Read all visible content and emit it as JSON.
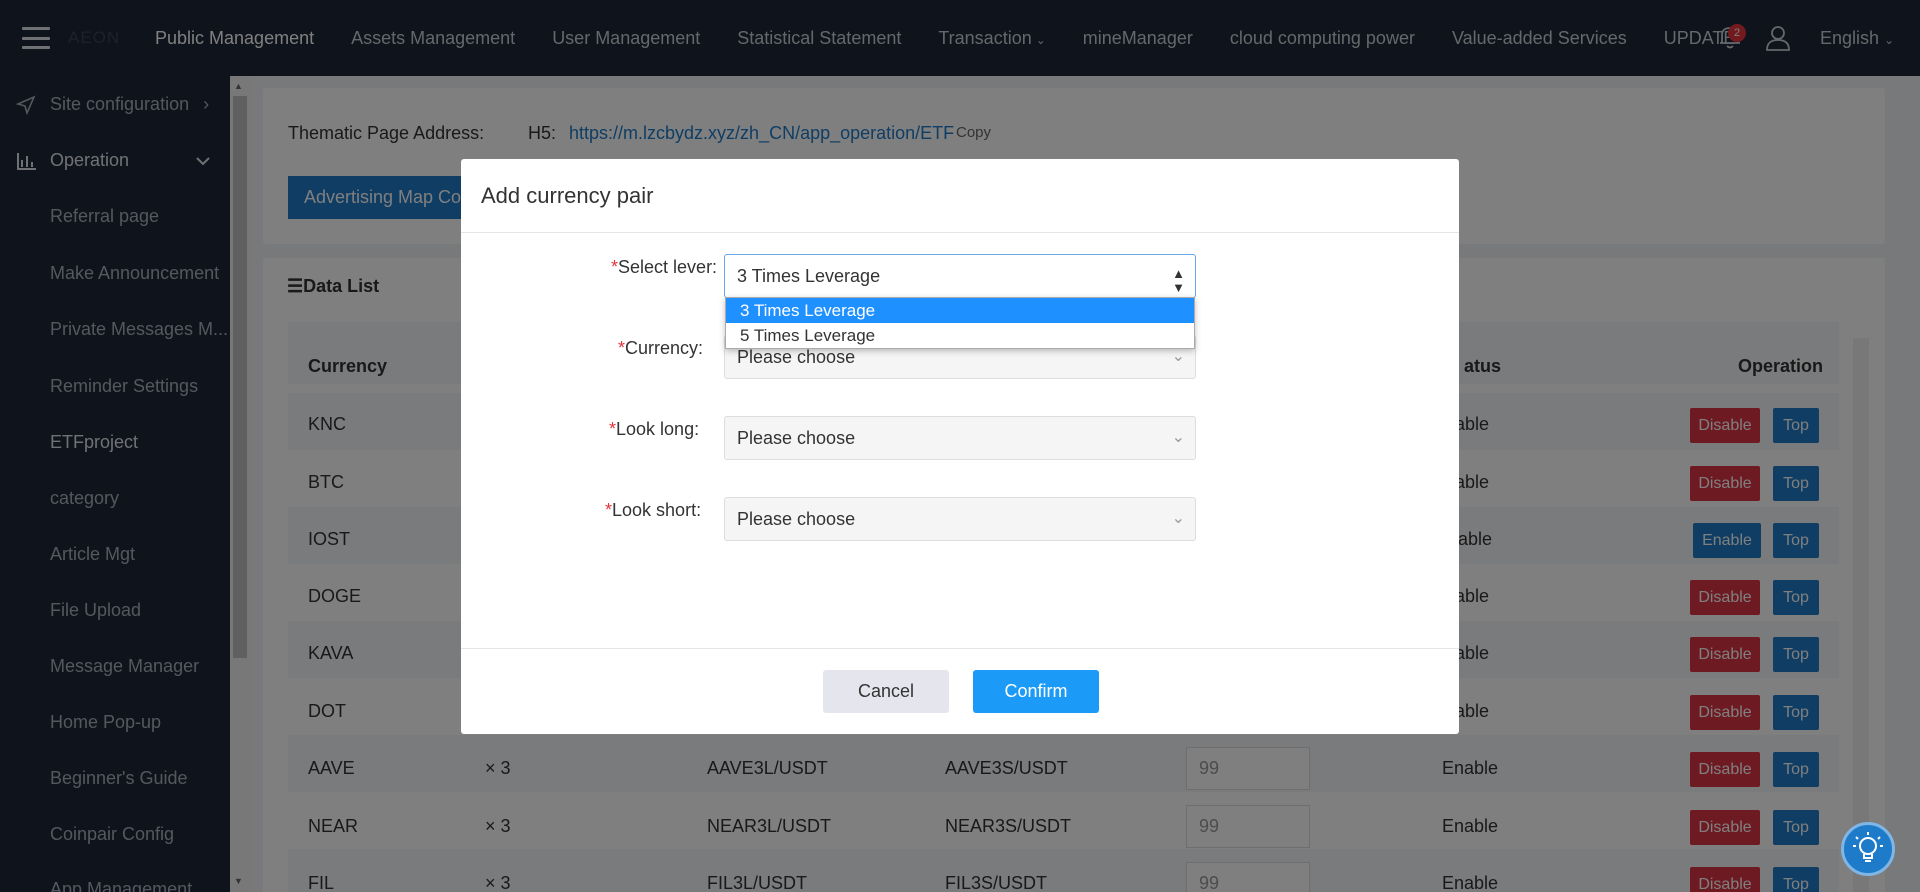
{
  "header": {
    "brand": "AEON",
    "nav": [
      "Public Management",
      "Assets Management",
      "User Management",
      "Statistical Statement",
      "Transaction",
      "mineManager",
      "cloud computing power",
      "Value-added Services",
      "UPDATE"
    ],
    "badge_count": "2",
    "language": "English"
  },
  "sidebar": {
    "site_configuration": "Site configuration",
    "operation": "Operation",
    "items": [
      "Referral page",
      "Make Announcement",
      "Private Messages M...",
      "Reminder Settings",
      "ETFproject",
      "category",
      "Article Mgt",
      "File Upload",
      "Message Manager",
      "Home Pop-up",
      "Beginner's Guide",
      "Coinpair Config"
    ],
    "app_management": "App Management"
  },
  "thematic": {
    "label": "Thematic Page Address:",
    "h5_label": "H5:",
    "url": "https://m.lzcbydz.xyz/zh_CN/app_operation/ETF",
    "copy": "Copy",
    "advertising_button": "Advertising Map Co"
  },
  "data_list": {
    "title": "Data List",
    "headers": {
      "currency": "Currency",
      "status": "atus",
      "operation": "Operation"
    },
    "rows": [
      {
        "currency": "KNC",
        "lever": "",
        "long": "",
        "short": "",
        "sort": "",
        "status": "nable",
        "action": "Disable",
        "top": "Top"
      },
      {
        "currency": "BTC",
        "lever": "",
        "long": "",
        "short": "",
        "sort": "",
        "status": "nable",
        "action": "Disable",
        "top": "Top"
      },
      {
        "currency": "IOST",
        "lever": "",
        "long": "",
        "short": "",
        "sort": "",
        "status": "isable",
        "action": "Enable",
        "top": "Top"
      },
      {
        "currency": "DOGE",
        "lever": "",
        "long": "",
        "short": "",
        "sort": "",
        "status": "nable",
        "action": "Disable",
        "top": "Top"
      },
      {
        "currency": "KAVA",
        "lever": "",
        "long": "",
        "short": "",
        "sort": "",
        "status": "nable",
        "action": "Disable",
        "top": "Top"
      },
      {
        "currency": "DOT",
        "lever": "",
        "long": "",
        "short": "",
        "sort": "",
        "status": "nable",
        "action": "Disable",
        "top": "Top"
      },
      {
        "currency": "AAVE",
        "lever": "× 3",
        "long": "AAVE3L/USDT",
        "short": "AAVE3S/USDT",
        "sort": "99",
        "status": "Enable",
        "action": "Disable",
        "top": "Top"
      },
      {
        "currency": "NEAR",
        "lever": "× 3",
        "long": "NEAR3L/USDT",
        "short": "NEAR3S/USDT",
        "sort": "99",
        "status": "Enable",
        "action": "Disable",
        "top": "Top"
      },
      {
        "currency": "FIL",
        "lever": "× 3",
        "long": "FIL3L/USDT",
        "short": "FIL3S/USDT",
        "sort": "99",
        "status": "Enable",
        "action": "Disable",
        "top": "Top"
      }
    ]
  },
  "modal": {
    "title": "Add currency pair",
    "select_lever_label": "Select lever:",
    "select_lever_value": "3 Times Leverage",
    "lever_options": [
      "3 Times Leverage",
      "5 Times Leverage"
    ],
    "currency_label": "Currency:",
    "look_long_label": "Look long:",
    "look_short_label": "Look short:",
    "placeholder": "Please choose",
    "cancel": "Cancel",
    "confirm": "Confirm"
  },
  "colors": {
    "topbar": "#1f2636",
    "primary": "#1b9af7",
    "danger": "#dc3545",
    "dropdown_highlight": "#1e90ff"
  }
}
